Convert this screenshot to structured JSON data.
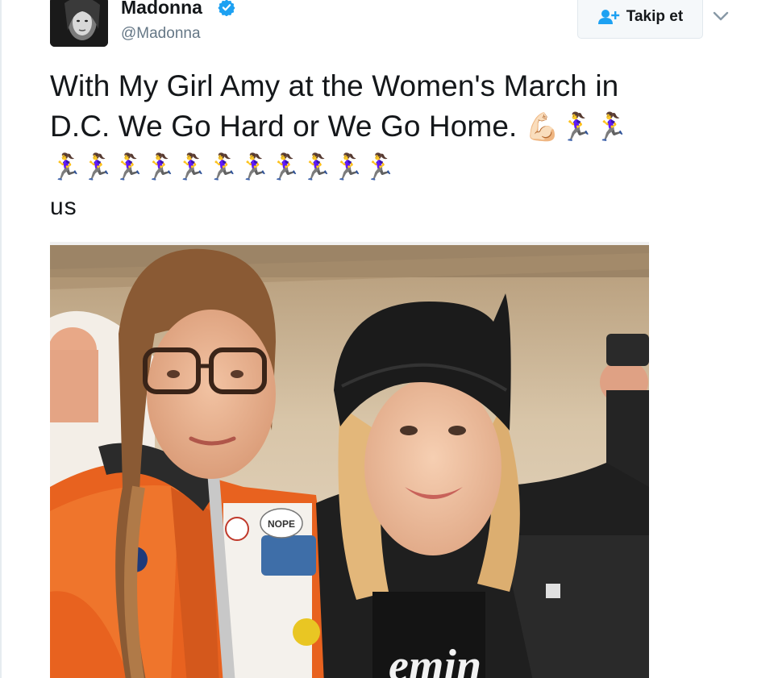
{
  "tweet": {
    "author": {
      "display_name": "Madonna",
      "screen_name": "@Madonna",
      "verified": true,
      "avatar_icon": "avatar-portrait"
    },
    "follow_button": {
      "label": "Takip et",
      "icon": "follow-user-plus-icon"
    },
    "more_menu_icon": "chevron-down-icon",
    "text": {
      "line1": "With My Girl Amy at the Women's March in",
      "line2_text": "D.C. We Go Hard or We Go Home.",
      "line2_emoji": "💪🏻🏃‍♀🏃‍♀",
      "line3": "🏃‍♀🏃‍♀🏃‍♀🏃‍♀🏃‍♀🏃‍♀🏃‍♀🏃‍♀🏃‍♀🏃‍♀🏃‍♀",
      "line4": "us"
    },
    "media": {
      "type": "photo",
      "shirt_text": "emin",
      "badge_text": "NOPE"
    }
  },
  "colors": {
    "verified_blue": "#1da1f2",
    "handle_gray": "#657786",
    "text": "#14171a",
    "follow_border": "#e1e8ed"
  }
}
